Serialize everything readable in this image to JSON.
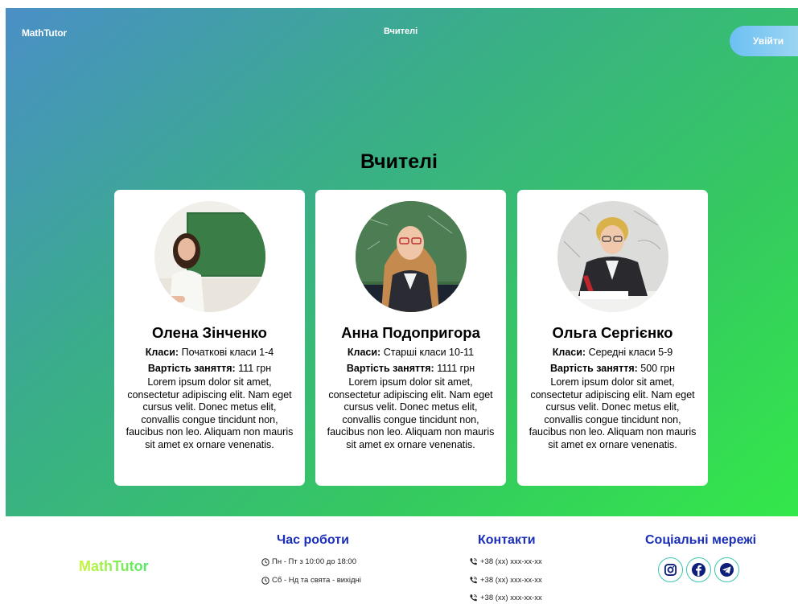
{
  "nav": {
    "logo": "MathTutor",
    "links": [
      "Вчителі"
    ],
    "login_label": "Увійти"
  },
  "main": {
    "title": "Вчителі",
    "teachers": [
      {
        "name": "Олена Зінченко",
        "classes_label": "Класи:",
        "classes": "Початкові класи 1-4",
        "price_label": "Вартість заняття:",
        "price": "111 грн",
        "description": "Lorem ipsum dolor sit amet, consectetur adipiscing elit. Nam eget cursus velit. Donec metus elit, convallis congue tincidunt non, faucibus non leo. Aliquam non mauris sit amet ex ornare venenatis."
      },
      {
        "name": "Анна Подопригора",
        "classes_label": "Класи:",
        "classes": "Старші класи 10-11",
        "price_label": "Вартість заняття:",
        "price": "1111 грн",
        "description": "Lorem ipsum dolor sit amet, consectetur adipiscing elit. Nam eget cursus velit. Donec metus elit, convallis congue tincidunt non, faucibus non leo. Aliquam non mauris sit amet ex ornare venenatis."
      },
      {
        "name": "Ольга Сергієнко",
        "classes_label": "Класи:",
        "classes": "Середні класи 5-9",
        "price_label": "Вартість заняття:",
        "price": "500 грн",
        "description": "Lorem ipsum dolor sit amet, consectetur adipiscing elit. Nam eget cursus velit. Donec metus elit, convallis congue tincidunt non, faucibus non leo. Aliquam non mauris sit amet ex ornare venenatis."
      }
    ]
  },
  "footer": {
    "logo": "MathTutor",
    "hours_title": "Час роботи",
    "hours": [
      "Пн - Пт з 10:00 до 18:00",
      "Сб - Нд та свята - вихідні"
    ],
    "contacts_title": "Контакти",
    "phones": [
      "+38 (xx) xxx-xx-xx",
      "+38 (xx) xxx-xx-xx",
      "+38 (xx) xxx-xx-xx"
    ],
    "social_title": "Соціальні мережі",
    "social_icons": [
      "instagram-icon",
      "facebook-icon",
      "telegram-icon"
    ]
  },
  "colors": {
    "hero_gradient_start": "#4a8fc7",
    "hero_gradient_end": "#33e84a",
    "footer_heading": "#1a2eb8",
    "login_button": "#6cc0f3"
  }
}
